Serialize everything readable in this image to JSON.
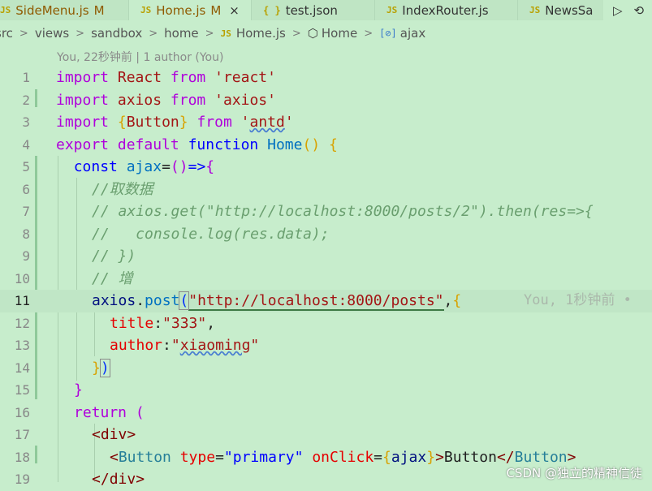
{
  "tabs": [
    {
      "label": "SideMenu.js",
      "badge": "M",
      "icon": "js-icon",
      "active": false
    },
    {
      "label": "Home.js",
      "badge": "M",
      "icon": "js-icon",
      "active": true,
      "close": "×"
    },
    {
      "label": "test.json",
      "icon": "json-icon",
      "active": false
    },
    {
      "label": "IndexRouter.js",
      "icon": "js-icon",
      "active": false
    },
    {
      "label": "NewsSa",
      "icon": "js-icon",
      "active": false
    }
  ],
  "tab_icons": {
    "js": "JS",
    "json": "{ }"
  },
  "tab_actions": {
    "run": "▷",
    "more": "⟲"
  },
  "breadcrumb": {
    "parts": [
      "src",
      "views",
      "sandbox",
      "home",
      "Home.js",
      "Home",
      "ajax"
    ],
    "sep": ">",
    "js_icon": "JS",
    "cube_icon": "⬡",
    "symbol_icon": "[⊘]"
  },
  "codelens": "You, 22秒钟前 | 1 author (You)",
  "blame": "You, 1秒钟前 •",
  "watermark": "CSDN @独立的精神信徒",
  "current_line": 11,
  "lines": [
    {
      "n": "1"
    },
    {
      "n": "2"
    },
    {
      "n": "3"
    },
    {
      "n": "4"
    },
    {
      "n": "5"
    },
    {
      "n": "6"
    },
    {
      "n": "7"
    },
    {
      "n": "8"
    },
    {
      "n": "9"
    },
    {
      "n": "10"
    },
    {
      "n": "11"
    },
    {
      "n": "12"
    },
    {
      "n": "13"
    },
    {
      "n": "14"
    },
    {
      "n": "15"
    },
    {
      "n": "16"
    },
    {
      "n": "17"
    },
    {
      "n": "18"
    },
    {
      "n": "19"
    }
  ],
  "code": {
    "l1": [
      "import",
      "React",
      "from",
      "'react'"
    ],
    "l2": [
      "import",
      "axios",
      "from",
      "'axios'"
    ],
    "l3": [
      "import",
      "{",
      "Button",
      "}",
      "from",
      "'",
      "antd",
      "'"
    ],
    "l4": [
      "export",
      "default",
      "function",
      "Home",
      "()",
      "{"
    ],
    "l5": [
      "const",
      "ajax",
      "=",
      "()",
      "=>",
      "{"
    ],
    "l6": "//取数据",
    "l7": "// axios.get(\"http://localhost:8000/posts/2\").then(res=>{",
    "l8": "//   console.log(res.data);",
    "l9": "// })",
    "l10": "// 增",
    "l11": [
      "axios",
      ".",
      "post",
      "(",
      "\"http://localhost:8000/posts\"",
      ",",
      "{"
    ],
    "l12": [
      "title",
      ":",
      "\"333\"",
      ","
    ],
    "l13": [
      "author",
      ":",
      "\"",
      "xiaoming",
      "\""
    ],
    "l14": [
      "}",
      ")"
    ],
    "l15": "}",
    "l16": [
      "return",
      "("
    ],
    "l17": [
      "<",
      "div",
      ">"
    ],
    "l18": [
      "<",
      "Button",
      "type",
      "=",
      "\"primary\"",
      "onClick",
      "=",
      "{",
      "ajax",
      "}",
      ">",
      "Button",
      "</",
      "Button",
      ">"
    ],
    "l19": [
      "</",
      "div",
      ">"
    ]
  }
}
